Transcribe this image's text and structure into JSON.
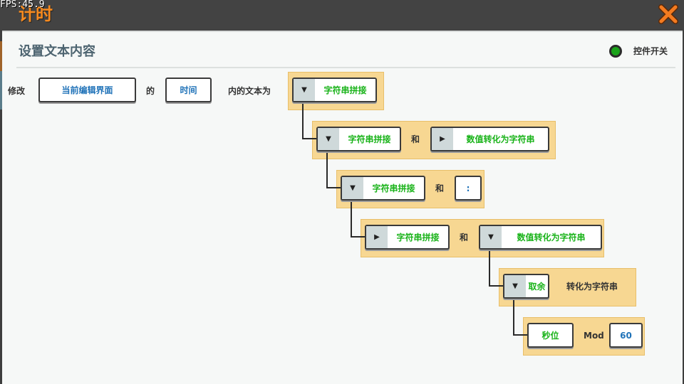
{
  "fps": "FPS:45.9",
  "title": "计时",
  "panel": {
    "title": "设置文本内容",
    "toggle_label": "控件开关"
  },
  "colors": {
    "title_orange": "#f68a1f",
    "close_x": "#f47b20",
    "toggle_on": "#1aa31a",
    "block_bg": "#f7d792",
    "string_green": "#19b319",
    "value_blue": "#1f72b8"
  },
  "sentence": {
    "modify": "修改",
    "ui": "当前编辑界面",
    "of": "的",
    "element": "时间",
    "text_to": "内的文本为"
  },
  "blocks": {
    "concat1": "字符串拼接",
    "concat2": "字符串拼接",
    "and1": "和",
    "num2str1": "数值转化为字符串",
    "concat3": "字符串拼接",
    "and2": "和",
    "colon": ":",
    "concat4": "字符串拼接",
    "and3": "和",
    "num2str2": "数值转化为字符串",
    "mod": "取余",
    "mod_suffix": "转化为字符串",
    "seconds": "秒位",
    "mod_op": "Mod",
    "mod_value": "60"
  }
}
